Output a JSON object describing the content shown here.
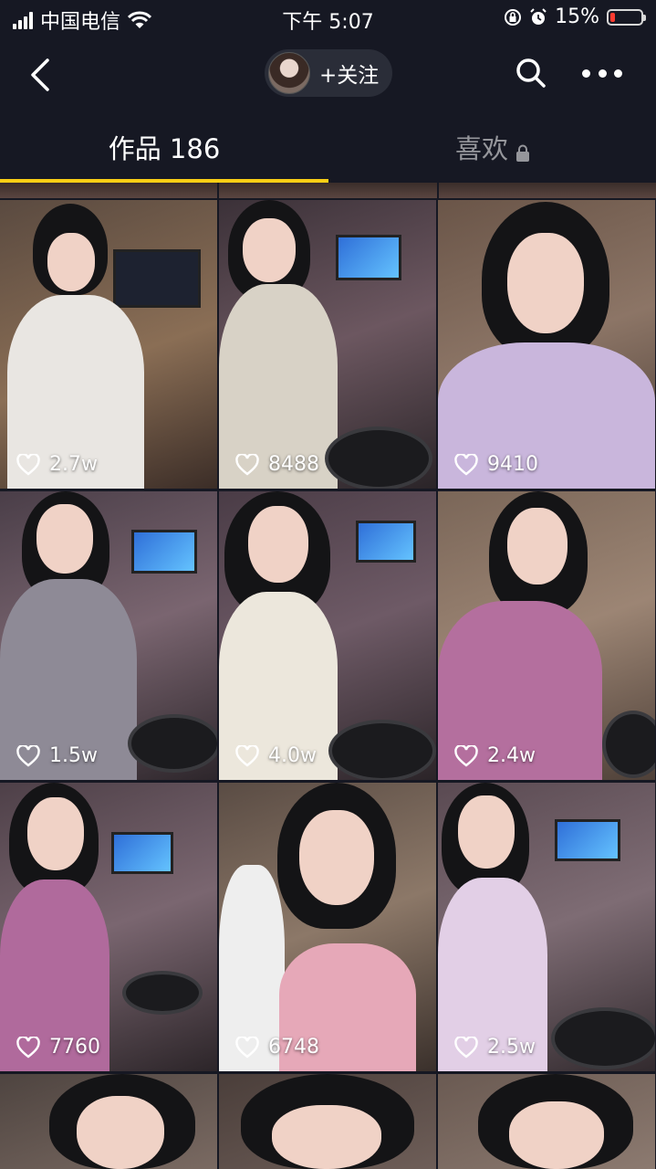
{
  "status_bar": {
    "carrier": "中国电信",
    "time": "下午 5:07",
    "battery_percent": "15%",
    "battery_level": 0.15,
    "battery_color": "#ff3b30"
  },
  "nav": {
    "follow_label": "+关注",
    "back_icon": "chevron-left-icon",
    "search_icon": "search-icon",
    "more_icon": "more-dots-icon"
  },
  "tabs": {
    "works_label": "作品 186",
    "likes_label": "喜欢",
    "accent": "#face15"
  },
  "videos": [
    {
      "likes": "2.7w"
    },
    {
      "likes": "8488"
    },
    {
      "likes": "9410"
    },
    {
      "likes": "1.5w"
    },
    {
      "likes": "4.0w"
    },
    {
      "likes": "2.4w"
    },
    {
      "likes": "7760"
    },
    {
      "likes": "6748"
    },
    {
      "likes": "2.5w"
    }
  ]
}
